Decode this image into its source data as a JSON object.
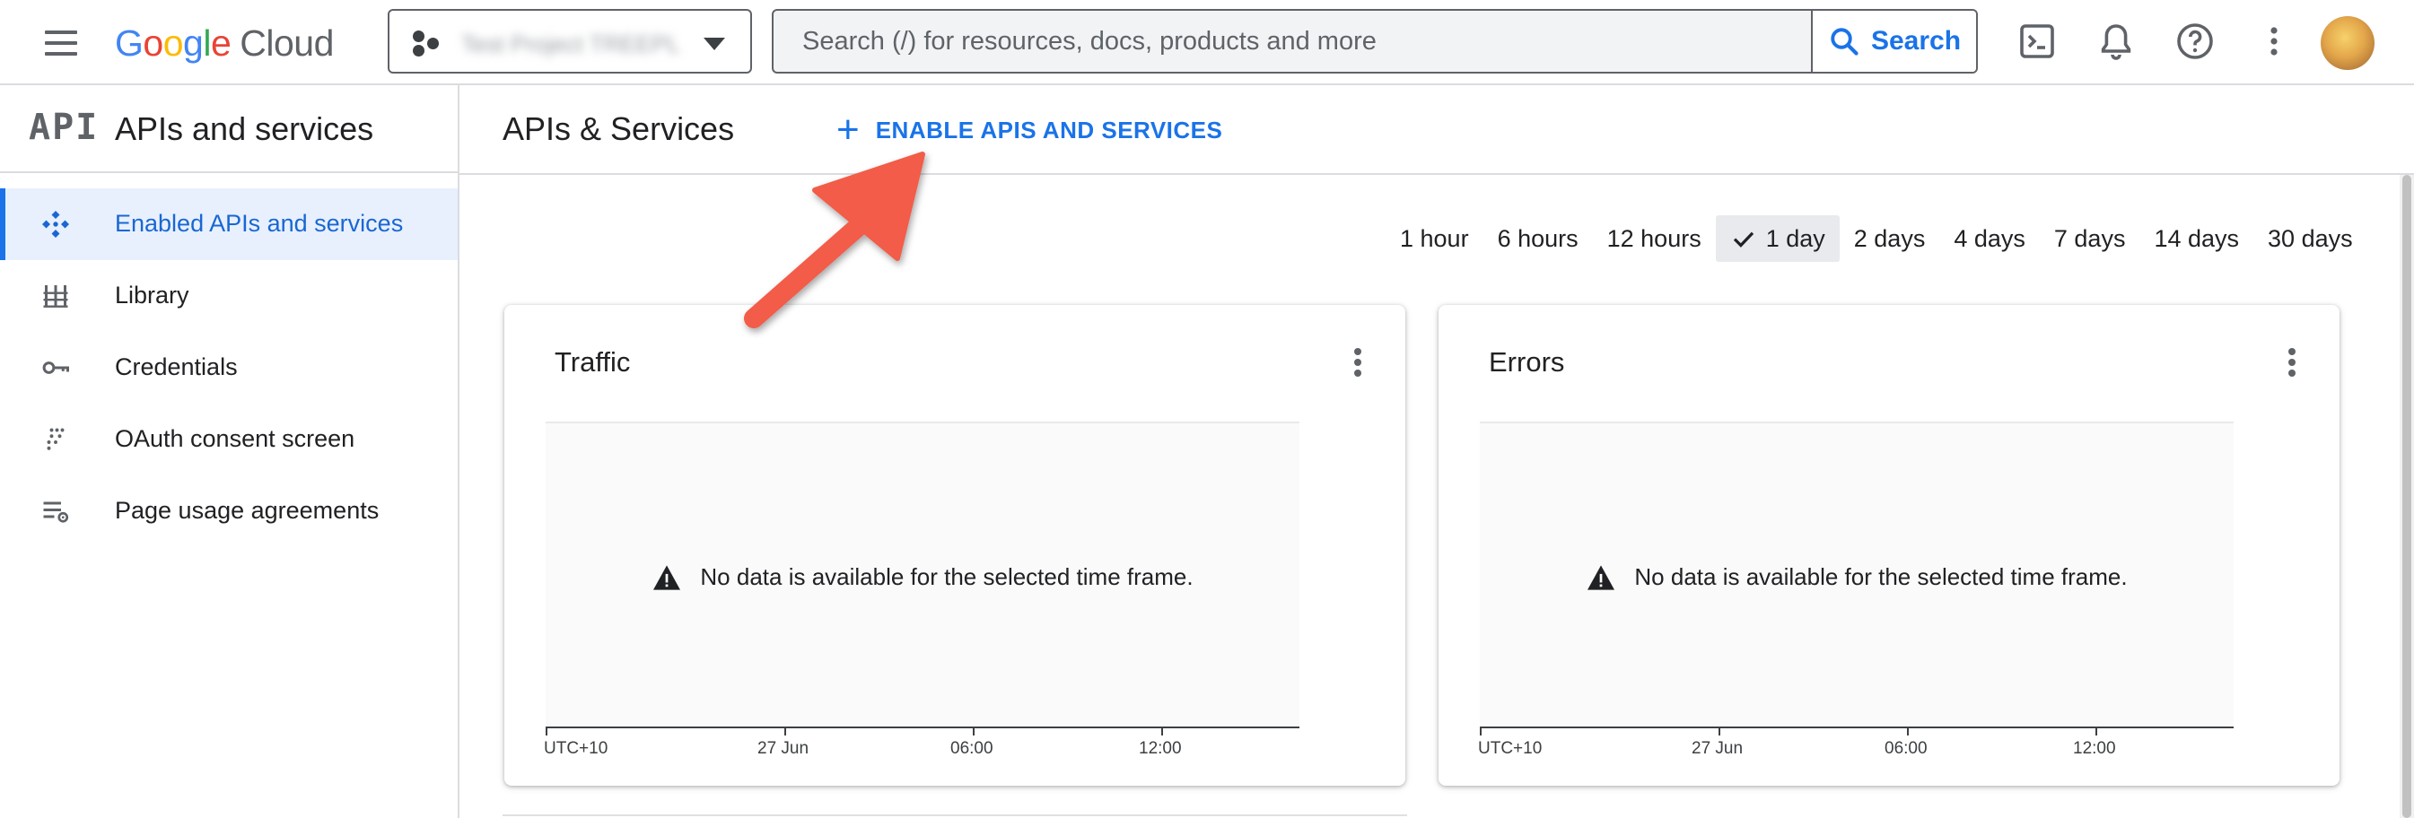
{
  "header": {
    "menu_icon": "hamburger-menu-icon",
    "logo": {
      "google": [
        "G",
        "o",
        "o",
        "g",
        "l",
        "e"
      ],
      "google_colors": [
        "#4285F4",
        "#EA4335",
        "#FBBC05",
        "#4285F4",
        "#34A853",
        "#EA4335"
      ],
      "cloud": "Cloud"
    },
    "project_name": "Test Project TREEPL",
    "search": {
      "placeholder": "Search (/) for resources, docs, products and more",
      "button_label": "Search"
    },
    "icons": [
      "cloud-shell-icon",
      "notifications-bell-icon",
      "help-icon",
      "more-vert-icon",
      "user-avatar"
    ]
  },
  "sidebar": {
    "logo_text": "API",
    "title": "APIs and services",
    "items": [
      {
        "label": "Enabled APIs and services",
        "icon": "enabled-apis-icon",
        "active": true
      },
      {
        "label": "Library",
        "icon": "library-icon",
        "active": false
      },
      {
        "label": "Credentials",
        "icon": "key-icon",
        "active": false
      },
      {
        "label": "OAuth consent screen",
        "icon": "oauth-consent-icon",
        "active": false
      },
      {
        "label": "Page usage agreements",
        "icon": "page-settings-icon",
        "active": false
      }
    ]
  },
  "main": {
    "title": "APIs & Services",
    "enable_button": {
      "icon": "+",
      "label": "ENABLE APIS AND SERVICES"
    },
    "time_options": [
      {
        "label": "1 hour",
        "selected": false
      },
      {
        "label": "6 hours",
        "selected": false
      },
      {
        "label": "12 hours",
        "selected": false
      },
      {
        "label": "1 day",
        "selected": true
      },
      {
        "label": "2 days",
        "selected": false
      },
      {
        "label": "4 days",
        "selected": false
      },
      {
        "label": "7 days",
        "selected": false
      },
      {
        "label": "14 days",
        "selected": false
      },
      {
        "label": "30 days",
        "selected": false
      }
    ],
    "cards": [
      {
        "title": "Traffic",
        "no_data": "No data is available for the selected time frame.",
        "x_ticks": [
          "UTC+10",
          "27 Jun",
          "06:00",
          "12:00"
        ]
      },
      {
        "title": "Errors",
        "no_data": "No data is available for the selected time frame.",
        "x_ticks": [
          "UTC+10",
          "27 Jun",
          "06:00",
          "12:00"
        ]
      }
    ]
  },
  "colors": {
    "accent": "#1a73e8",
    "active_bg": "#e8f0fe",
    "annotation_arrow": "#f25c4a"
  }
}
